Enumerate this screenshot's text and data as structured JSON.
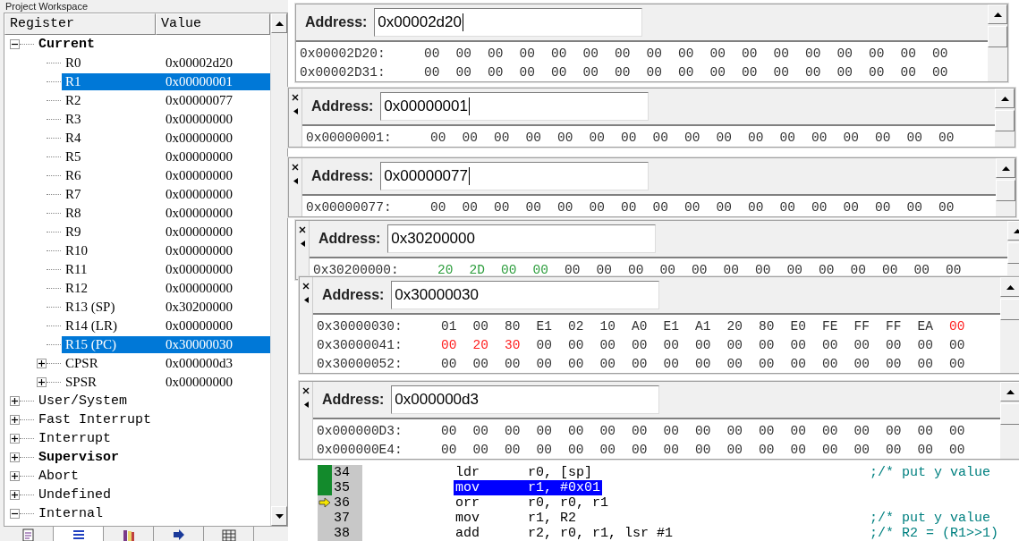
{
  "workspace": {
    "title": "Project Workspace"
  },
  "registers": {
    "columns": [
      "Register",
      "Value"
    ],
    "tree": [
      {
        "label": "Current",
        "bold": true,
        "expanded": true,
        "selected": false,
        "children": [
          {
            "label": "R0",
            "value": "0x00002d20",
            "selected": false
          },
          {
            "label": "R1",
            "value": "0x00000001",
            "selected": true
          },
          {
            "label": "R2",
            "value": "0x00000077",
            "selected": false
          },
          {
            "label": "R3",
            "value": "0x00000000",
            "selected": false
          },
          {
            "label": "R4",
            "value": "0x00000000",
            "selected": false
          },
          {
            "label": "R5",
            "value": "0x00000000",
            "selected": false
          },
          {
            "label": "R6",
            "value": "0x00000000",
            "selected": false
          },
          {
            "label": "R7",
            "value": "0x00000000",
            "selected": false
          },
          {
            "label": "R8",
            "value": "0x00000000",
            "selected": false
          },
          {
            "label": "R9",
            "value": "0x00000000",
            "selected": false
          },
          {
            "label": "R10",
            "value": "0x00000000",
            "selected": false
          },
          {
            "label": "R11",
            "value": "0x00000000",
            "selected": false
          },
          {
            "label": "R12",
            "value": "0x00000000",
            "selected": false
          },
          {
            "label": "R13 (SP)",
            "value": "0x30200000",
            "selected": false
          },
          {
            "label": "R14 (LR)",
            "value": "0x00000000",
            "selected": false
          },
          {
            "label": "R15 (PC)",
            "value": "0x30000030",
            "selected": true
          },
          {
            "label": "CPSR",
            "value": "0x000000d3",
            "expanded": false,
            "selected": false
          },
          {
            "label": "SPSR",
            "value": "0x00000000",
            "expanded": false,
            "selected": false
          }
        ]
      },
      {
        "label": "User/System",
        "bold": false,
        "expanded": false,
        "selected": false
      },
      {
        "label": "Fast Interrupt",
        "bold": false,
        "expanded": false,
        "selected": false
      },
      {
        "label": "Interrupt",
        "bold": false,
        "expanded": false,
        "selected": false
      },
      {
        "label": "Supervisor",
        "bold": true,
        "expanded": false,
        "selected": false
      },
      {
        "label": "Abort",
        "bold": false,
        "expanded": false,
        "selected": false
      },
      {
        "label": "Undefined",
        "bold": false,
        "expanded": false,
        "selected": false
      },
      {
        "label": "Internal",
        "bold": false,
        "expanded": true,
        "selected": false
      }
    ]
  },
  "workspace_tabs": [
    {
      "kind": "document",
      "selected": false
    },
    {
      "kind": "list",
      "selected": true
    },
    {
      "kind": "books",
      "selected": false
    },
    {
      "kind": "arrow",
      "selected": false
    },
    {
      "kind": "grid",
      "selected": false
    }
  ],
  "memory_windows": [
    {
      "label": "Address:",
      "address": "0x00002d20",
      "caret": true,
      "closable": false,
      "rows": [
        {
          "address": "0x00002D20:",
          "bytes": [
            "00",
            "00",
            "00",
            "00",
            "00",
            "00",
            "00",
            "00",
            "00",
            "00",
            "00",
            "00",
            "00",
            "00",
            "00",
            "00",
            "00"
          ]
        },
        {
          "address": "0x00002D31:",
          "bytes": [
            "00",
            "00",
            "00",
            "00",
            "00",
            "00",
            "00",
            "00",
            "00",
            "00",
            "00",
            "00",
            "00",
            "00",
            "00",
            "00",
            "00"
          ]
        }
      ]
    },
    {
      "label": "Address:",
      "address": "0x00000001",
      "caret": true,
      "closable": true,
      "rows": [
        {
          "address": "0x00000001:",
          "bytes": [
            "00",
            "00",
            "00",
            "00",
            "00",
            "00",
            "00",
            "00",
            "00",
            "00",
            "00",
            "00",
            "00",
            "00",
            "00",
            "00",
            "00"
          ]
        }
      ]
    },
    {
      "label": "Address:",
      "address": "0x00000077",
      "caret": true,
      "closable": true,
      "rows": [
        {
          "address": "0x00000077:",
          "bytes": [
            "00",
            "00",
            "00",
            "00",
            "00",
            "00",
            "00",
            "00",
            "00",
            "00",
            "00",
            "00",
            "00",
            "00",
            "00",
            "00",
            "00"
          ]
        }
      ]
    },
    {
      "label": "Address:",
      "address": "0x30200000",
      "caret": false,
      "closable": true,
      "rows": [
        {
          "address": "0x30200000:",
          "bytes": [
            {
              "text": "20",
              "color": "#2e9e3e"
            },
            {
              "text": "2D",
              "color": "#2e9e3e"
            },
            {
              "text": "00",
              "color": "#2e9e3e"
            },
            {
              "text": "00",
              "color": "#2e9e3e"
            },
            "00",
            "00",
            "00",
            "00",
            "00",
            "00",
            "00",
            "00",
            "00",
            "00",
            "00",
            "00",
            "00"
          ]
        }
      ]
    },
    {
      "label": "Address:",
      "address": "0x30000030",
      "caret": false,
      "closable": true,
      "rows": [
        {
          "address": "0x30000030:",
          "bytes": [
            "01",
            "00",
            "80",
            "E1",
            "02",
            "10",
            "A0",
            "E1",
            "A1",
            "20",
            "80",
            "E0",
            "FE",
            "FF",
            "FF",
            "EA",
            {
              "text": "00",
              "color": "#ff2020"
            }
          ]
        },
        {
          "address": "0x30000041:",
          "bytes": [
            {
              "text": "00",
              "color": "#ff2020"
            },
            {
              "text": "20",
              "color": "#ff2020"
            },
            {
              "text": "30",
              "color": "#ff2020"
            },
            "00",
            "00",
            "00",
            "00",
            "00",
            "00",
            "00",
            "00",
            "00",
            "00",
            "00",
            "00",
            "00",
            "00"
          ]
        },
        {
          "address": "0x30000052:",
          "bytes": [
            "00",
            "00",
            "00",
            "00",
            "00",
            "00",
            "00",
            "00",
            "00",
            "00",
            "00",
            "00",
            "00",
            "00",
            "00",
            "00",
            "00"
          ]
        }
      ]
    },
    {
      "label": "Address:",
      "address": "0x000000d3",
      "caret": false,
      "closable": true,
      "rows": [
        {
          "address": "0x000000D3:",
          "bytes": [
            "00",
            "00",
            "00",
            "00",
            "00",
            "00",
            "00",
            "00",
            "00",
            "00",
            "00",
            "00",
            "00",
            "00",
            "00",
            "00",
            "00"
          ]
        },
        {
          "address": "0x000000E4:",
          "bytes": [
            "00",
            "00",
            "00",
            "00",
            "00",
            "00",
            "00",
            "00",
            "00",
            "00",
            "00",
            "00",
            "00",
            "00",
            "00",
            "00",
            "00"
          ]
        }
      ]
    }
  ],
  "code_lines": [
    {
      "number": "34",
      "code": "ldr      r0, [sp]",
      "comment": ";/* put y value",
      "breakpoint": true,
      "current": false,
      "selected": false
    },
    {
      "number": "35",
      "code": "mov      r1, #0x01",
      "breakpoint": true,
      "current": false,
      "selected": true
    },
    {
      "number": "36",
      "code": "orr      r0, r0, r1",
      "breakpoint": false,
      "current": true,
      "selected": false
    },
    {
      "number": "37",
      "code": "mov      r1, R2",
      "comment": ";/* put y value",
      "breakpoint": false,
      "current": false,
      "selected": false
    },
    {
      "number": "38",
      "code": "add      r2, r0, r1, lsr #1",
      "comment": ";/* R2 = (R1>>1)",
      "breakpoint": false,
      "current": false,
      "selected": false
    }
  ]
}
